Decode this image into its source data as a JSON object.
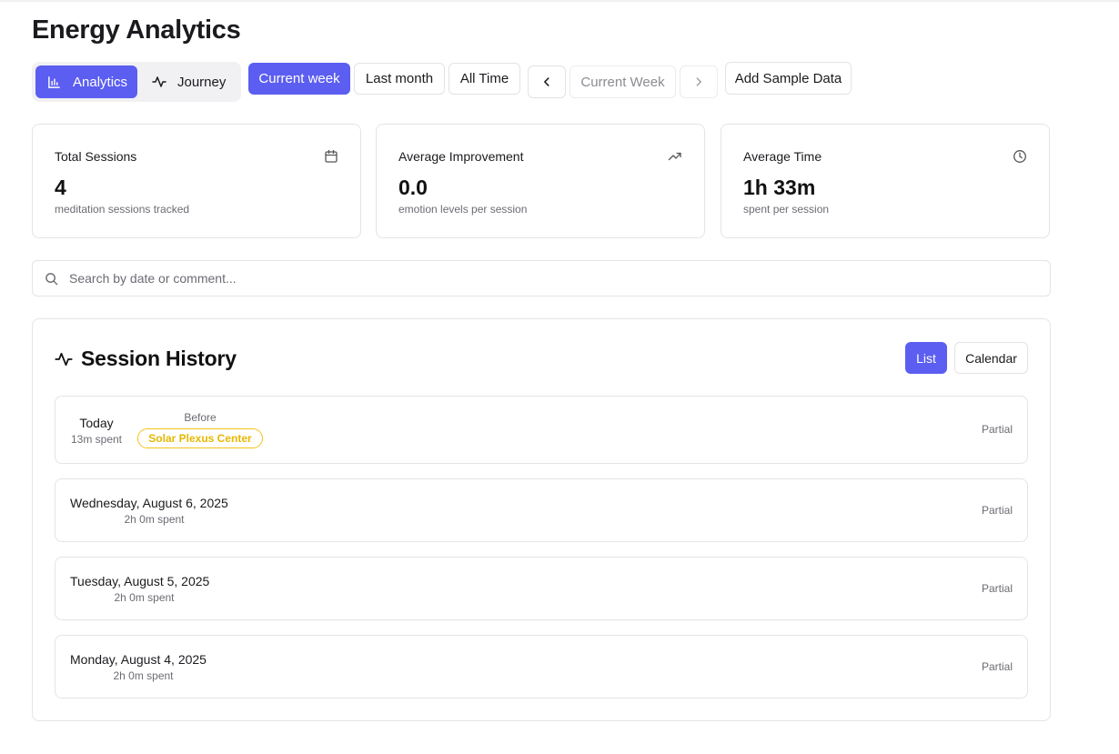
{
  "page": {
    "title": "Energy Analytics"
  },
  "toolbar": {
    "views": [
      {
        "label": "Analytics",
        "icon": "bar-chart-icon",
        "active": true
      },
      {
        "label": "Journey",
        "icon": "activity-icon",
        "active": false
      }
    ],
    "ranges": [
      {
        "label": "Current week",
        "active": true
      },
      {
        "label": "Last month",
        "active": false
      },
      {
        "label": "All Time",
        "active": false
      }
    ],
    "period_label": "Current Week",
    "prev_icon": "chevron-left-icon",
    "next_icon": "chevron-right-icon",
    "sample_label": "Add Sample Data"
  },
  "stats": [
    {
      "title": "Total Sessions",
      "value": "4",
      "sub": "meditation sessions tracked",
      "icon": "calendar-icon"
    },
    {
      "title": "Average Improvement",
      "value": "0.0",
      "sub": "emotion levels per session",
      "icon": "trending-up-icon"
    },
    {
      "title": "Average Time",
      "value": "1h 33m",
      "sub": "spent per session",
      "icon": "clock-icon"
    }
  ],
  "search": {
    "placeholder": "Search by date or comment...",
    "value": ""
  },
  "history": {
    "title": "Session History",
    "views": [
      {
        "label": "List",
        "active": true
      },
      {
        "label": "Calendar",
        "active": false
      }
    ],
    "sessions": [
      {
        "date": "Today",
        "spent": "13m spent",
        "before_label": "Before",
        "chakra": "Solar Plexus Center",
        "chakra_color": "#f2c318",
        "status": "Partial"
      },
      {
        "date": "Wednesday, August 6, 2025",
        "spent": "2h 0m spent",
        "status": "Partial"
      },
      {
        "date": "Tuesday, August 5, 2025",
        "spent": "2h 0m spent",
        "status": "Partial"
      },
      {
        "date": "Monday, August 4, 2025",
        "spent": "2h 0m spent",
        "status": "Partial"
      }
    ]
  },
  "colors": {
    "accent": "#5b5ef0",
    "border": "#e4e4e9",
    "muted_text": "#6b6b73",
    "chakra_yellow": "#f2c318"
  }
}
